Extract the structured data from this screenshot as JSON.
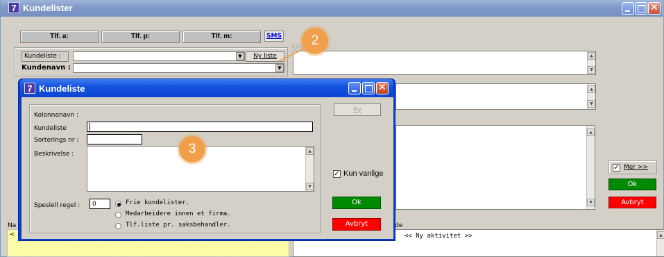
{
  "main_window": {
    "icon_label": "7",
    "title": "Kundelister",
    "phone": {
      "tlf_a": "Tlf. a:",
      "tlf_p": "Tlf. p:",
      "tlf_m": "Tlf. m:",
      "sms": "SMS"
    },
    "kundeliste_label": "Kundeliste :",
    "ny_liste": "Ny liste",
    "faded_hint": "Kilde",
    "kundenavn_label": "Kundenavn :",
    "mer_label": "Mer >>",
    "ok": "Ok",
    "avbryt": "Avbryt",
    "bottom_left_label": "Na",
    "bottom_left_arrow": "<",
    "bottom_mid_label": "de",
    "ny_aktivitet": "<< Ny aktivitet >>"
  },
  "callouts": {
    "two": "2",
    "three": "3"
  },
  "dialog": {
    "icon_label": "7",
    "title": "Kundeliste",
    "kolonnenavn_label": "Kolonnenavn :",
    "kundeliste_label": "Kundeliste",
    "kundeliste_value": "",
    "sortering_label": "Sorterings nr :",
    "sortering_value": "",
    "beskrivelse_label": "Beskrivelse :",
    "ny_button": "Ny",
    "kun_vanlige_label": "Kun vanlige",
    "kun_vanlige_checked": true,
    "ok": "Ok",
    "avbryt": "Avbryt",
    "spesiell_label": "Spesiell regel :",
    "spesiell_value": "0",
    "radio_options": [
      {
        "label": "Frie kundelister.",
        "selected": true
      },
      {
        "label": "Medarbeidere innen et firma.",
        "selected": false
      },
      {
        "label": "Tlf.liste pr. saksbehandler.",
        "selected": false
      }
    ]
  },
  "colors": {
    "ok_green": "#008a00",
    "cancel_red": "#ff0000",
    "callout_orange": "#f0a04b",
    "dialog_blue": "#0c45d0"
  }
}
